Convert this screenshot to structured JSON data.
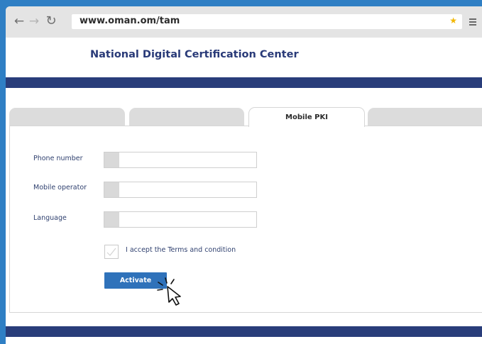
{
  "browser": {
    "url": "www.oman.om/tam",
    "icons": {
      "back": "arrow-left-icon",
      "forward": "arrow-right-icon",
      "reload": "reload-icon",
      "bookmark": "star-icon",
      "menu": "hamburger-menu-icon"
    }
  },
  "site": {
    "title": "National Digital Certification Center"
  },
  "tabs": [
    {
      "label": ""
    },
    {
      "label": ""
    },
    {
      "label": "Mobile PKI",
      "active": true
    },
    {
      "label": ""
    }
  ],
  "form": {
    "phone_label": "Phone number",
    "phone_value": "",
    "operator_label": "Mobile operator",
    "operator_value": "",
    "language_label": "Language",
    "language_value": "",
    "terms_label": "I accept the Terms and condition",
    "terms_checked": false,
    "activate_label": "Activate"
  },
  "colors": {
    "frame": "#2f7fc4",
    "band": "#293d7a",
    "button": "#2f72ba",
    "title": "#293a78"
  }
}
